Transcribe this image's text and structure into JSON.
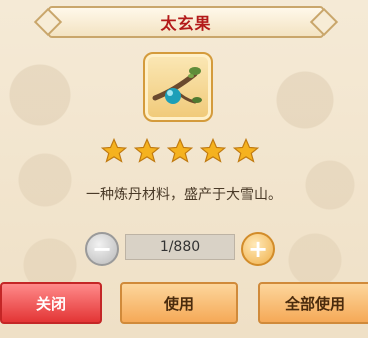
{
  "item": {
    "name": "太玄果",
    "description": "一种炼丹材料，盛产于大雪山。",
    "stars": 5,
    "icon": "branch-fruit-icon"
  },
  "quantity": {
    "display": "1/880"
  },
  "buttons": {
    "close": "关闭",
    "use": "使用",
    "use_all": "全部使用"
  },
  "colors": {
    "title": "#b31a1a",
    "close_button": "#e33535",
    "action_button": "#f5a957",
    "star": "#f5b21f"
  }
}
